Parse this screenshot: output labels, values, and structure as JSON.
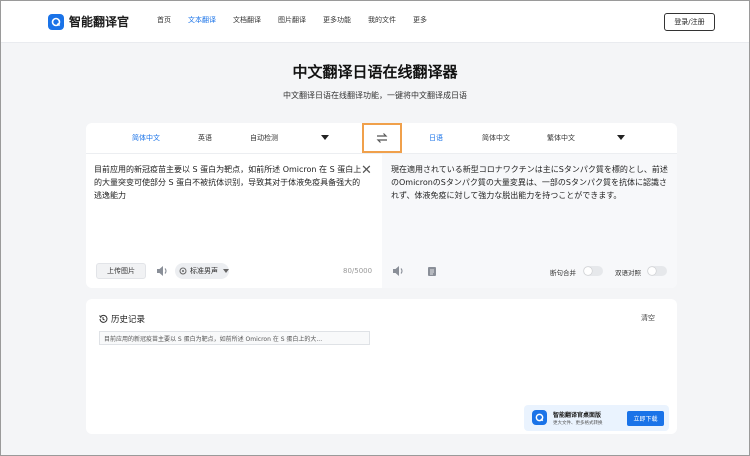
{
  "app": {
    "name": "智能翻译官",
    "login_label": "登录/注册"
  },
  "nav": {
    "items": [
      {
        "label": "首页"
      },
      {
        "label": "文本翻译"
      },
      {
        "label": "文档翻译"
      },
      {
        "label": "图片翻译"
      },
      {
        "label": "更多功能"
      },
      {
        "label": "我的文件"
      },
      {
        "label": "更多"
      }
    ],
    "active": "文本翻译"
  },
  "hero": {
    "title": "中文翻译日语在线翻译器",
    "subtitle": "中文翻译日语在线翻译功能，一键将中文翻译成日语"
  },
  "translator": {
    "source_langs": [
      "简体中文",
      "英语",
      "自动检测"
    ],
    "source_selected": "简体中文",
    "target_langs": [
      "日语",
      "简体中文",
      "繁体中文"
    ],
    "target_selected": "日语",
    "source_text": "目前应用的新冠疫苗主要以 S 蛋白为靶点，如前所述 Omicron 在 S 蛋白上的大量突变可使部分 S 蛋白不被抗体识别，导致其对于体液免疫具备强大的逃逸能力",
    "target_text": "現在適用されている新型コロナワクチンは主にSタンパク質を標的とし、前述のOmicronのSタンパク質の大量変異は、一部のSタンパク質を抗体に認識されず、体液免疫に対して強力な脱出能力を持つことができます。",
    "upload_label": "上传图片",
    "voice_label": "标准男声",
    "char_count": "80/5000",
    "toggle_merge_label": "断句合并",
    "toggle_bilingual_label": "双语对照",
    "merge_on": false,
    "bilingual_on": false
  },
  "history": {
    "title": "历史记录",
    "clear_label": "清空",
    "items": [
      {
        "text": "目前应用的新冠疫苗主要以 S 蛋白为靶点，如前所述 Omicron 在 S 蛋白上的大..."
      }
    ]
  },
  "promo": {
    "title": "智能翻译官桌面版",
    "subtitle": "更大文件、更多格式转换",
    "button_label": "立即下载"
  },
  "colors": {
    "accent": "#1a73e8",
    "swap_highlight": "#f0a04b",
    "background": "#f4f5f7"
  },
  "icons": [
    "app-logo-icon",
    "swap-icon",
    "close-icon",
    "speaker-icon",
    "copy-icon",
    "history-icon",
    "chevron-down-icon"
  ]
}
